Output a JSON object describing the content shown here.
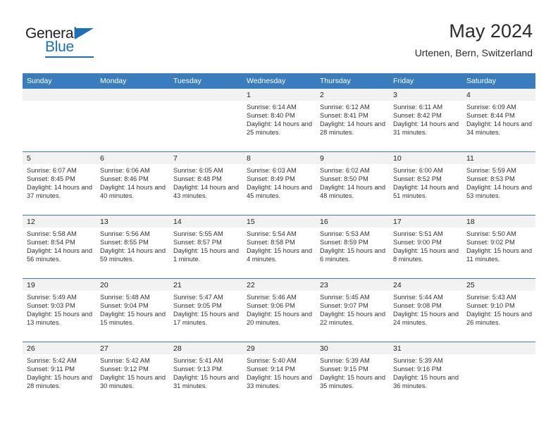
{
  "brand": {
    "name_part1": "General",
    "name_part2": "Blue",
    "logo_icon": "triangle-logo-icon",
    "accent_color": "#1b70b8"
  },
  "header": {
    "title": "May 2024",
    "subtitle": "Urtenen, Bern, Switzerland"
  },
  "theme": {
    "header_row_color": "#3a7dbf",
    "date_band_color": "#f2f2f2",
    "row_divider_color": "#3a7dbf"
  },
  "weekdays": [
    "Sunday",
    "Monday",
    "Tuesday",
    "Wednesday",
    "Thursday",
    "Friday",
    "Saturday"
  ],
  "labels": {
    "sunrise_prefix": "Sunrise:",
    "sunset_prefix": "Sunset:",
    "daylight_prefix": "Daylight:"
  },
  "weeks": [
    [
      {
        "blank": true,
        "date": ""
      },
      {
        "blank": true,
        "date": ""
      },
      {
        "blank": true,
        "date": ""
      },
      {
        "blank": false,
        "date": "1",
        "sunrise": "Sunrise: 6:14 AM",
        "sunset": "Sunset: 8:40 PM",
        "daylight": "Daylight: 14 hours and 25 minutes."
      },
      {
        "blank": false,
        "date": "2",
        "sunrise": "Sunrise: 6:12 AM",
        "sunset": "Sunset: 8:41 PM",
        "daylight": "Daylight: 14 hours and 28 minutes."
      },
      {
        "blank": false,
        "date": "3",
        "sunrise": "Sunrise: 6:11 AM",
        "sunset": "Sunset: 8:42 PM",
        "daylight": "Daylight: 14 hours and 31 minutes."
      },
      {
        "blank": false,
        "date": "4",
        "sunrise": "Sunrise: 6:09 AM",
        "sunset": "Sunset: 8:44 PM",
        "daylight": "Daylight: 14 hours and 34 minutes."
      }
    ],
    [
      {
        "blank": false,
        "date": "5",
        "sunrise": "Sunrise: 6:07 AM",
        "sunset": "Sunset: 8:45 PM",
        "daylight": "Daylight: 14 hours and 37 minutes."
      },
      {
        "blank": false,
        "date": "6",
        "sunrise": "Sunrise: 6:06 AM",
        "sunset": "Sunset: 8:46 PM",
        "daylight": "Daylight: 14 hours and 40 minutes."
      },
      {
        "blank": false,
        "date": "7",
        "sunrise": "Sunrise: 6:05 AM",
        "sunset": "Sunset: 8:48 PM",
        "daylight": "Daylight: 14 hours and 43 minutes."
      },
      {
        "blank": false,
        "date": "8",
        "sunrise": "Sunrise: 6:03 AM",
        "sunset": "Sunset: 8:49 PM",
        "daylight": "Daylight: 14 hours and 45 minutes."
      },
      {
        "blank": false,
        "date": "9",
        "sunrise": "Sunrise: 6:02 AM",
        "sunset": "Sunset: 8:50 PM",
        "daylight": "Daylight: 14 hours and 48 minutes."
      },
      {
        "blank": false,
        "date": "10",
        "sunrise": "Sunrise: 6:00 AM",
        "sunset": "Sunset: 8:52 PM",
        "daylight": "Daylight: 14 hours and 51 minutes."
      },
      {
        "blank": false,
        "date": "11",
        "sunrise": "Sunrise: 5:59 AM",
        "sunset": "Sunset: 8:53 PM",
        "daylight": "Daylight: 14 hours and 53 minutes."
      }
    ],
    [
      {
        "blank": false,
        "date": "12",
        "sunrise": "Sunrise: 5:58 AM",
        "sunset": "Sunset: 8:54 PM",
        "daylight": "Daylight: 14 hours and 56 minutes."
      },
      {
        "blank": false,
        "date": "13",
        "sunrise": "Sunrise: 5:56 AM",
        "sunset": "Sunset: 8:55 PM",
        "daylight": "Daylight: 14 hours and 59 minutes."
      },
      {
        "blank": false,
        "date": "14",
        "sunrise": "Sunrise: 5:55 AM",
        "sunset": "Sunset: 8:57 PM",
        "daylight": "Daylight: 15 hours and 1 minute."
      },
      {
        "blank": false,
        "date": "15",
        "sunrise": "Sunrise: 5:54 AM",
        "sunset": "Sunset: 8:58 PM",
        "daylight": "Daylight: 15 hours and 4 minutes."
      },
      {
        "blank": false,
        "date": "16",
        "sunrise": "Sunrise: 5:53 AM",
        "sunset": "Sunset: 8:59 PM",
        "daylight": "Daylight: 15 hours and 6 minutes."
      },
      {
        "blank": false,
        "date": "17",
        "sunrise": "Sunrise: 5:51 AM",
        "sunset": "Sunset: 9:00 PM",
        "daylight": "Daylight: 15 hours and 8 minutes."
      },
      {
        "blank": false,
        "date": "18",
        "sunrise": "Sunrise: 5:50 AM",
        "sunset": "Sunset: 9:02 PM",
        "daylight": "Daylight: 15 hours and 11 minutes."
      }
    ],
    [
      {
        "blank": false,
        "date": "19",
        "sunrise": "Sunrise: 5:49 AM",
        "sunset": "Sunset: 9:03 PM",
        "daylight": "Daylight: 15 hours and 13 minutes."
      },
      {
        "blank": false,
        "date": "20",
        "sunrise": "Sunrise: 5:48 AM",
        "sunset": "Sunset: 9:04 PM",
        "daylight": "Daylight: 15 hours and 15 minutes."
      },
      {
        "blank": false,
        "date": "21",
        "sunrise": "Sunrise: 5:47 AM",
        "sunset": "Sunset: 9:05 PM",
        "daylight": "Daylight: 15 hours and 17 minutes."
      },
      {
        "blank": false,
        "date": "22",
        "sunrise": "Sunrise: 5:46 AM",
        "sunset": "Sunset: 9:06 PM",
        "daylight": "Daylight: 15 hours and 20 minutes."
      },
      {
        "blank": false,
        "date": "23",
        "sunrise": "Sunrise: 5:45 AM",
        "sunset": "Sunset: 9:07 PM",
        "daylight": "Daylight: 15 hours and 22 minutes."
      },
      {
        "blank": false,
        "date": "24",
        "sunrise": "Sunrise: 5:44 AM",
        "sunset": "Sunset: 9:08 PM",
        "daylight": "Daylight: 15 hours and 24 minutes."
      },
      {
        "blank": false,
        "date": "25",
        "sunrise": "Sunrise: 5:43 AM",
        "sunset": "Sunset: 9:10 PM",
        "daylight": "Daylight: 15 hours and 26 minutes."
      }
    ],
    [
      {
        "blank": false,
        "date": "26",
        "sunrise": "Sunrise: 5:42 AM",
        "sunset": "Sunset: 9:11 PM",
        "daylight": "Daylight: 15 hours and 28 minutes."
      },
      {
        "blank": false,
        "date": "27",
        "sunrise": "Sunrise: 5:42 AM",
        "sunset": "Sunset: 9:12 PM",
        "daylight": "Daylight: 15 hours and 30 minutes."
      },
      {
        "blank": false,
        "date": "28",
        "sunrise": "Sunrise: 5:41 AM",
        "sunset": "Sunset: 9:13 PM",
        "daylight": "Daylight: 15 hours and 31 minutes."
      },
      {
        "blank": false,
        "date": "29",
        "sunrise": "Sunrise: 5:40 AM",
        "sunset": "Sunset: 9:14 PM",
        "daylight": "Daylight: 15 hours and 33 minutes."
      },
      {
        "blank": false,
        "date": "30",
        "sunrise": "Sunrise: 5:39 AM",
        "sunset": "Sunset: 9:15 PM",
        "daylight": "Daylight: 15 hours and 35 minutes."
      },
      {
        "blank": false,
        "date": "31",
        "sunrise": "Sunrise: 5:39 AM",
        "sunset": "Sunset: 9:16 PM",
        "daylight": "Daylight: 15 hours and 36 minutes."
      },
      {
        "blank": true,
        "date": ""
      }
    ]
  ]
}
